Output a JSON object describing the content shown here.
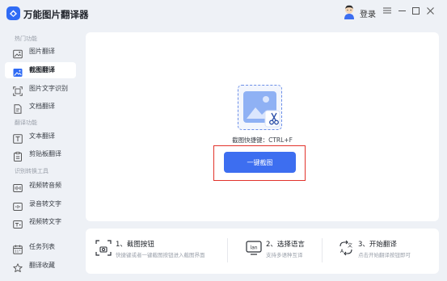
{
  "app": {
    "title": "万能图片翻译器"
  },
  "header": {
    "login_label": "登录"
  },
  "sidebar": {
    "sections": [
      {
        "label": "热门功能"
      },
      {
        "label": "翻译功能"
      },
      {
        "label": "识别转换工具"
      }
    ],
    "items": [
      {
        "label": "图片翻译"
      },
      {
        "label": "截图翻译"
      },
      {
        "label": "图片文字识别"
      },
      {
        "label": "文档翻译"
      },
      {
        "label": "文本翻译"
      },
      {
        "label": "剪贴板翻译"
      },
      {
        "label": "视频转音频"
      },
      {
        "label": "录音转文字"
      },
      {
        "label": "视频转文字"
      },
      {
        "label": "任务列表"
      },
      {
        "label": "翻译收藏"
      }
    ],
    "active_item": "截图翻译"
  },
  "main": {
    "shortcut_text": "截图快捷键：CTRL+F",
    "button_label": "一键截图"
  },
  "steps": [
    {
      "title": "1、截图按钮",
      "desc": "快捷键或者一键截图按钮进入截图界面"
    },
    {
      "title": "2、选择语言",
      "desc": "支持多语种互译"
    },
    {
      "title": "3、开始翻译",
      "desc": "点击开始翻译按钮即可"
    }
  ],
  "colors": {
    "accent": "#3d6ef0",
    "highlight_border": "#e2332b",
    "background": "#eef1f6"
  }
}
